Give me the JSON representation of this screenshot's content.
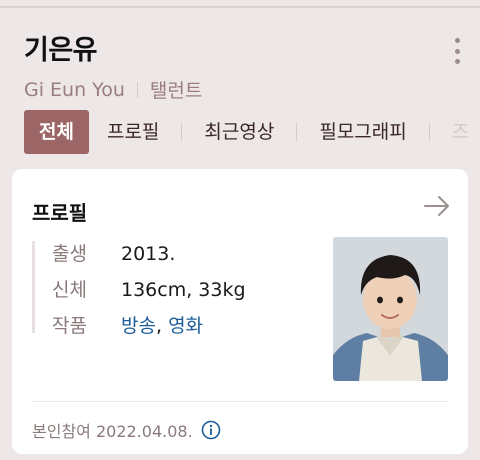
{
  "header": {
    "name_ko": "기은유",
    "name_en": "Gi Eun You",
    "category": "탤런트"
  },
  "tabs": [
    {
      "label": "전체",
      "active": true
    },
    {
      "label": "프로필",
      "active": false
    },
    {
      "label": "최근영상",
      "active": false
    },
    {
      "label": "필모그래피",
      "active": false
    },
    {
      "label": "즈",
      "active": false
    }
  ],
  "profile_card": {
    "title": "프로필",
    "rows": {
      "birth": {
        "key": "출생",
        "value": "2013."
      },
      "body": {
        "key": "신체",
        "value": "136cm, 33kg"
      },
      "works": {
        "key": "작품",
        "link1": "방송",
        "separator": ",",
        "link2": "영화"
      }
    },
    "footer": "본인참여 2022.04.08."
  },
  "colors": {
    "accent": "#9c6666",
    "link": "#1d5e9a",
    "background": "#ede7e7"
  }
}
